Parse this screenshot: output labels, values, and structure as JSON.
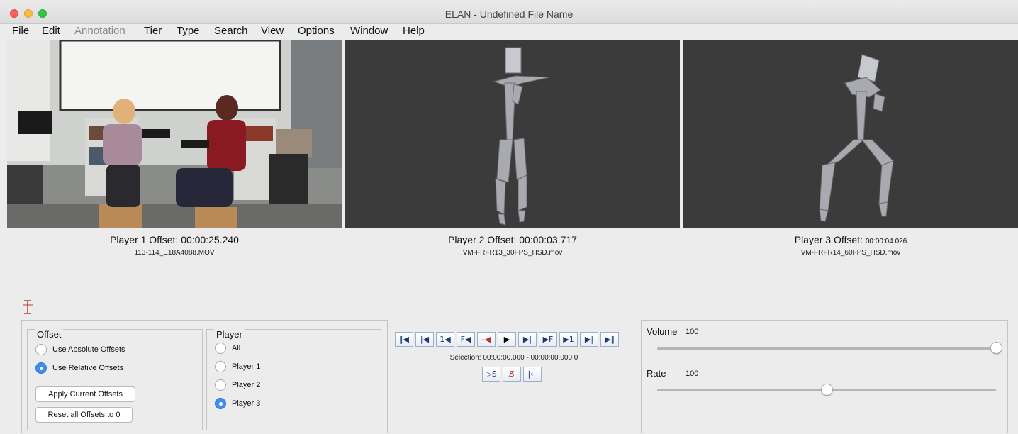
{
  "window": {
    "title": "ELAN - Undefined File Name"
  },
  "menu": [
    "File",
    "Edit",
    "Annotation",
    "Tier",
    "Type",
    "Search",
    "View",
    "Options",
    "Window",
    "Help"
  ],
  "players": [
    {
      "offset_label": "Player 1 Offset:",
      "offset_value": "00:00:25.240",
      "file": "113-114_E18A4088.MOV"
    },
    {
      "offset_label": "Player 2 Offset:",
      "offset_value": "00:00:03.717",
      "file": "VM-FRFR13_30FPS_HSD.mov"
    },
    {
      "offset_label": "Player 3 Offset:",
      "offset_value": "00:00:04.026",
      "file": "VM-FRFR14_60FPS_HSD.mov"
    }
  ],
  "offset_panel": {
    "title": "Offset",
    "options": [
      {
        "label": "Use Absolute Offsets",
        "selected": false
      },
      {
        "label": "Use Relative Offsets",
        "selected": true
      }
    ],
    "apply_label": "Apply Current Offsets",
    "reset_label": "Reset all Offsets to 0"
  },
  "player_panel": {
    "title": "Player",
    "options": [
      {
        "label": "All",
        "selected": false
      },
      {
        "label": "Player 1",
        "selected": false
      },
      {
        "label": "Player 2",
        "selected": false
      },
      {
        "label": "Player 3",
        "selected": true
      }
    ]
  },
  "controls": {
    "buttons": [
      "‖◀",
      "|◀",
      "1◀",
      "F◀",
      "-◀",
      "▶",
      "▶|",
      "▶F",
      "▶1",
      "▶|",
      "▶‖"
    ],
    "selection": "Selection: 00:00:00.000 - 00:00:00.000  0",
    "sub_buttons": [
      "▷S",
      "S̸",
      "|←"
    ]
  },
  "volume": {
    "label": "Volume",
    "value": "100",
    "level": 1.0
  },
  "rate": {
    "label": "Rate",
    "value": "100",
    "level": 0.5
  }
}
